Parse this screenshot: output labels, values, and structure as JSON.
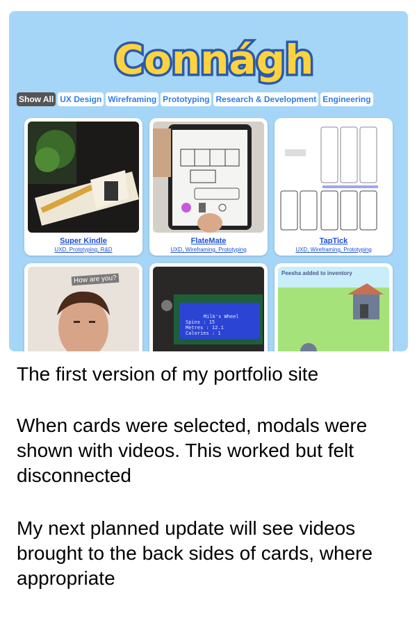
{
  "colors": {
    "background": "#a6d6f7",
    "pill_text": "#2f7fe0",
    "active_pill": "#555555",
    "link": "#1a4fd6"
  },
  "logo": {
    "text": "Connágh"
  },
  "filters": [
    {
      "label": "Show All",
      "active": true
    },
    {
      "label": "UX Design",
      "active": false
    },
    {
      "label": "Wireframing",
      "active": false
    },
    {
      "label": "Prototyping",
      "active": false
    },
    {
      "label": "Research & Development",
      "active": false
    },
    {
      "label": "Engineering",
      "active": false
    }
  ],
  "cards": [
    {
      "title": "Super Kindle",
      "tags": "UXD, Prototyping, R&D"
    },
    {
      "title": "FlateMate",
      "tags": "UXD, Wireframing, Prototyping"
    },
    {
      "title": "TapTick",
      "tags": "UXD, Wireframing, Prototyping"
    },
    {
      "overlay": "How are you?"
    },
    {
      "lcd_lines": [
        "Milk's Wheel",
        "Spins    : 15",
        "Metres   : 12.1",
        "Calories : 1"
      ]
    },
    {
      "overlay": "Peesha added to inventory"
    }
  ],
  "captions": {
    "line1": "The first version of my portfolio site",
    "para2": "When cards were selected, modals were shown with videos. This worked but felt disconnected",
    "para3": "My next planned update will see videos brought to the back sides of cards, where appropriate"
  }
}
